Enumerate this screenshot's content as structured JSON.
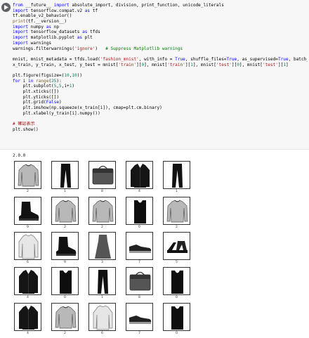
{
  "code_cell": {
    "run_button": "run-cell",
    "lines": [
      [
        {
          "t": "from",
          "c": "kw"
        },
        {
          "t": " __future__ "
        },
        {
          "t": "import",
          "c": "kw"
        },
        {
          "t": " absolute_import, division, print_function, unicode_literals"
        }
      ],
      [
        {
          "t": "import",
          "c": "kw"
        },
        {
          "t": " tensorflow.compat.v2 "
        },
        {
          "t": "as",
          "c": "kw"
        },
        {
          "t": " tf"
        }
      ],
      [
        {
          "t": "tf.enable_v2_behavior()"
        }
      ],
      [
        {
          "t": "print",
          "c": "fn"
        },
        {
          "t": "(tf.__version__)"
        }
      ],
      [
        {
          "t": "import",
          "c": "kw"
        },
        {
          "t": " numpy "
        },
        {
          "t": "as",
          "c": "kw"
        },
        {
          "t": " np"
        }
      ],
      [
        {
          "t": "import",
          "c": "kw"
        },
        {
          "t": " tensorflow_datasets "
        },
        {
          "t": "as",
          "c": "kw"
        },
        {
          "t": " tfds"
        }
      ],
      [
        {
          "t": "import",
          "c": "kw"
        },
        {
          "t": " matplotlib.pyplot "
        },
        {
          "t": "as",
          "c": "kw"
        },
        {
          "t": " plt"
        }
      ],
      [
        {
          "t": "import",
          "c": "kw"
        },
        {
          "t": " warnings"
        }
      ],
      [
        {
          "t": "warnings.filterwarnings("
        },
        {
          "t": "'ignore'",
          "c": "st"
        },
        {
          "t": ")   "
        },
        {
          "t": "# Suppress Matplotlib warnings",
          "c": "cm"
        }
      ],
      [
        {
          "t": ""
        }
      ],
      [
        {
          "t": "mnist, mnist_metadata = tfds.load("
        },
        {
          "t": "'fashion_mnist'",
          "c": "st"
        },
        {
          "t": ", with_info = "
        },
        {
          "t": "True",
          "c": "bl"
        },
        {
          "t": ", shuffle_files="
        },
        {
          "t": "True",
          "c": "bl"
        },
        {
          "t": ", as_supervised="
        },
        {
          "t": "True",
          "c": "bl"
        },
        {
          "t": ", batch_size = "
        },
        {
          "t": "-1",
          "c": "num"
        },
        {
          "t": ")"
        }
      ],
      [
        {
          "t": "x_train, y_train, x_test, y_test = mnist["
        },
        {
          "t": "'train'",
          "c": "st"
        },
        {
          "t": "]["
        },
        {
          "t": "0",
          "c": "num"
        },
        {
          "t": "], mnist["
        },
        {
          "t": "'train'",
          "c": "st"
        },
        {
          "t": "]["
        },
        {
          "t": "1",
          "c": "num"
        },
        {
          "t": "], mnist["
        },
        {
          "t": "'test'",
          "c": "st"
        },
        {
          "t": "]["
        },
        {
          "t": "0",
          "c": "num"
        },
        {
          "t": "], mnist["
        },
        {
          "t": "'test'",
          "c": "st"
        },
        {
          "t": "]["
        },
        {
          "t": "1",
          "c": "num"
        },
        {
          "t": "]"
        }
      ],
      [
        {
          "t": ""
        }
      ],
      [
        {
          "t": "plt.figure(figsize=("
        },
        {
          "t": "10",
          "c": "num"
        },
        {
          "t": ","
        },
        {
          "t": "10",
          "c": "num"
        },
        {
          "t": "))"
        }
      ],
      [
        {
          "t": "for",
          "c": "kw"
        },
        {
          "t": " i "
        },
        {
          "t": "in",
          "c": "kw"
        },
        {
          "t": " "
        },
        {
          "t": "range",
          "c": "fn"
        },
        {
          "t": "("
        },
        {
          "t": "25",
          "c": "num"
        },
        {
          "t": "):"
        }
      ],
      [
        {
          "t": "    plt.subplot("
        },
        {
          "t": "5",
          "c": "num"
        },
        {
          "t": ","
        },
        {
          "t": "5",
          "c": "num"
        },
        {
          "t": ",i+"
        },
        {
          "t": "1",
          "c": "num"
        },
        {
          "t": ")"
        }
      ],
      [
        {
          "t": "    plt.xticks([])"
        }
      ],
      [
        {
          "t": "    plt.yticks([])"
        }
      ],
      [
        {
          "t": "    plt.grid("
        },
        {
          "t": "False",
          "c": "bl"
        },
        {
          "t": ")"
        }
      ],
      [
        {
          "t": "    plt.imshow(np.squeeze(x_train[i]), cmap=plt.cm.binary)"
        }
      ],
      [
        {
          "t": "    plt.xlabel(y_train[i].numpy())"
        }
      ],
      [
        {
          "t": ""
        }
      ],
      [
        {
          "t": "# 確認表示",
          "c": "cj"
        }
      ],
      [
        {
          "t": "plt.show()"
        }
      ]
    ]
  },
  "output": {
    "version": "2.0.0"
  },
  "figure": {
    "items": [
      {
        "label": "2",
        "icon": "pullover-icon"
      },
      {
        "label": "1",
        "icon": "trouser-icon"
      },
      {
        "label": "8",
        "icon": "bag-icon"
      },
      {
        "label": "4",
        "icon": "coat-icon"
      },
      {
        "label": "1",
        "icon": "trouser-icon"
      },
      {
        "label": "9",
        "icon": "ankle-boot-icon"
      },
      {
        "label": "2",
        "icon": "pullover-icon"
      },
      {
        "label": "2",
        "icon": "pullover-icon"
      },
      {
        "label": "0",
        "icon": "tshirt-top-icon"
      },
      {
        "label": "2",
        "icon": "pullover-icon"
      },
      {
        "label": "6",
        "icon": "shirt-icon"
      },
      {
        "label": "9",
        "icon": "ankle-boot-icon"
      },
      {
        "label": "3",
        "icon": "dress-icon"
      },
      {
        "label": "7",
        "icon": "sneaker-icon"
      },
      {
        "label": "5",
        "icon": "sandal-icon"
      },
      {
        "label": "4",
        "icon": "coat-icon"
      },
      {
        "label": "0",
        "icon": "tshirt-top-icon"
      },
      {
        "label": "1",
        "icon": "trouser-icon"
      },
      {
        "label": "8",
        "icon": "bag-icon"
      },
      {
        "label": "0",
        "icon": "tshirt-top-icon"
      },
      {
        "label": "4",
        "icon": "coat-icon"
      },
      {
        "label": "2",
        "icon": "pullover-icon"
      },
      {
        "label": "6",
        "icon": "shirt-icon"
      },
      {
        "label": "7",
        "icon": "sneaker-icon"
      },
      {
        "label": "0",
        "icon": "tshirt-top-icon"
      }
    ]
  }
}
